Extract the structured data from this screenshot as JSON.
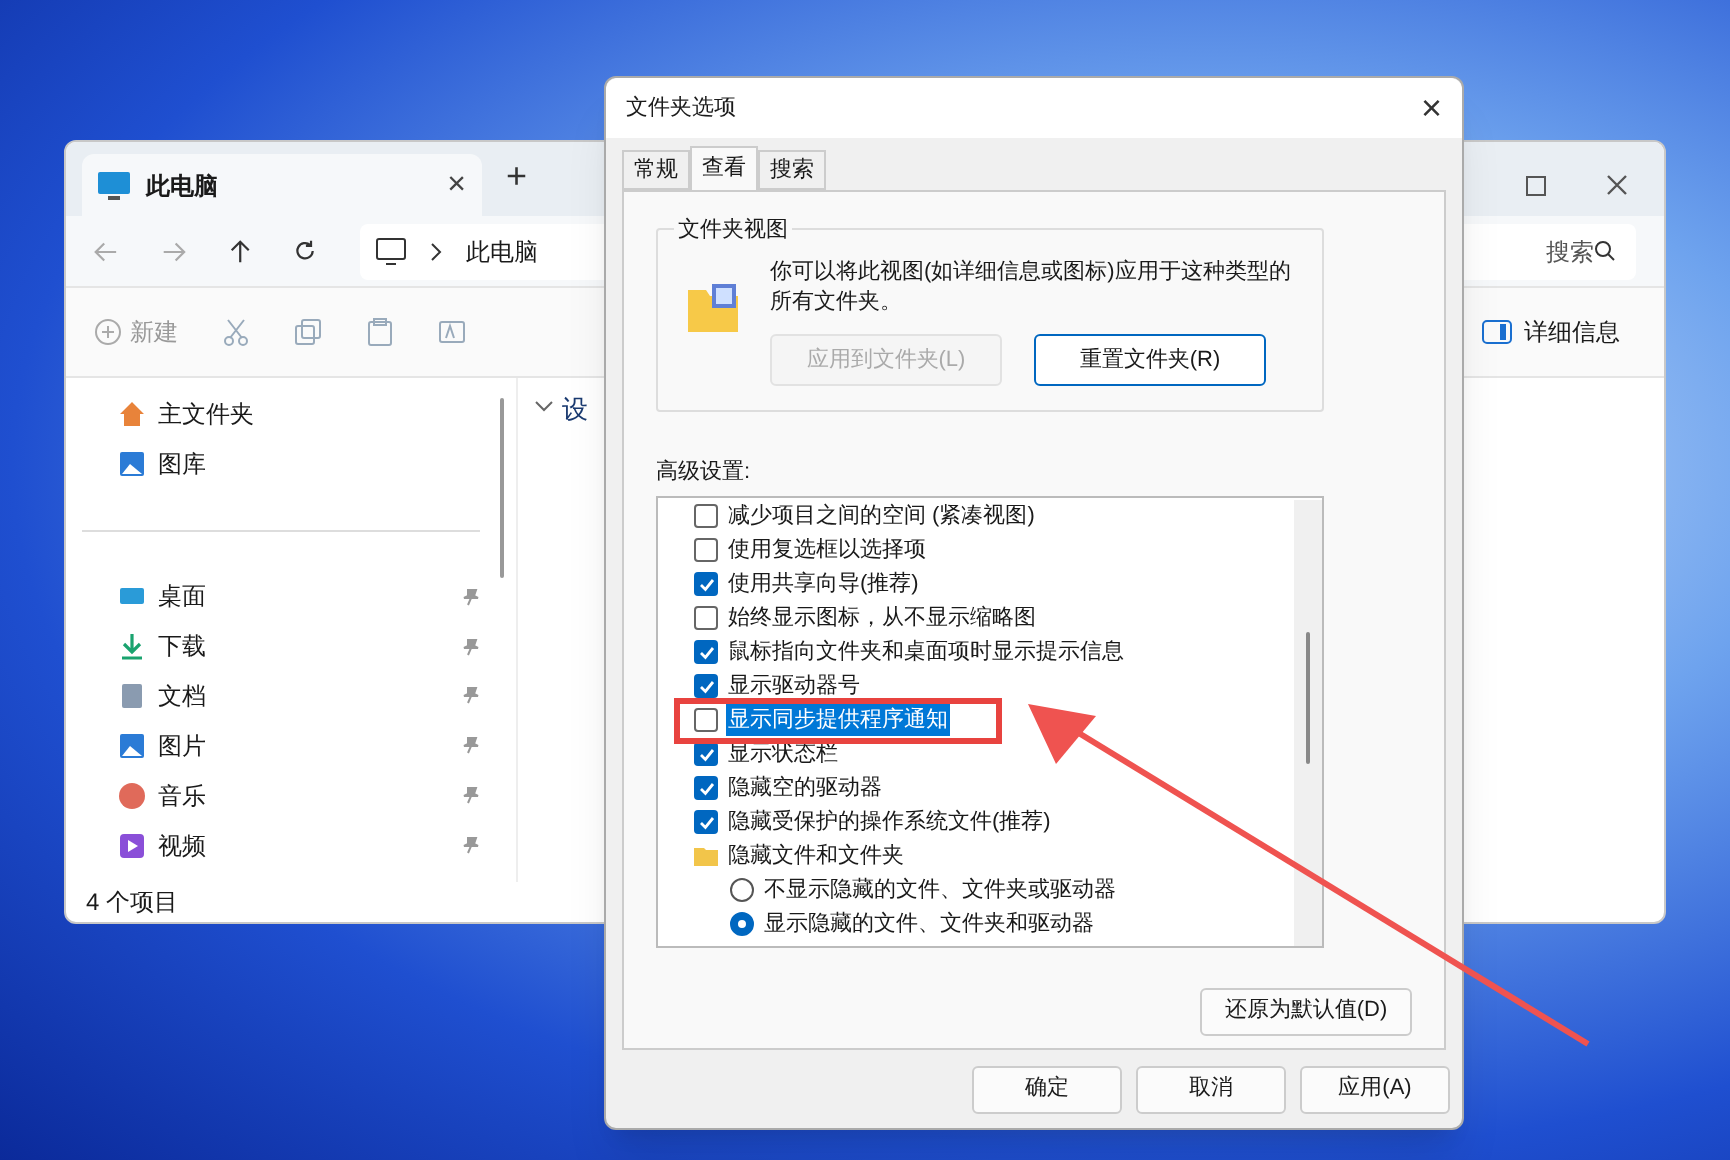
{
  "explorer": {
    "tab": {
      "title": "此电脑",
      "close": "×"
    },
    "new_tab": "+",
    "address": "此电脑",
    "search": {
      "placeholder": "搜索"
    },
    "toolbar": {
      "new": "新建",
      "details": "详细信息"
    },
    "sidebar": {
      "items": [
        {
          "label": "主文件夹",
          "kind": "home",
          "pinned": false
        },
        {
          "label": "图库",
          "kind": "gallery",
          "pinned": false
        },
        {
          "label": "桌面",
          "kind": "desktop",
          "pinned": true
        },
        {
          "label": "下载",
          "kind": "downloads",
          "pinned": true
        },
        {
          "label": "文档",
          "kind": "documents",
          "pinned": true
        },
        {
          "label": "图片",
          "kind": "pictures",
          "pinned": true
        },
        {
          "label": "音乐",
          "kind": "music",
          "pinned": true
        },
        {
          "label": "视频",
          "kind": "videos",
          "pinned": true
        }
      ]
    },
    "section": "设",
    "status": "4 个项目"
  },
  "dialog": {
    "title": "文件夹选项",
    "close": "×",
    "tabs": [
      {
        "label": "常规",
        "selected": false
      },
      {
        "label": "查看",
        "selected": true
      },
      {
        "label": "搜索",
        "selected": false
      }
    ],
    "group": {
      "title": "文件夹视图",
      "text": "你可以将此视图(如详细信息或图标)应用于这种类型的所有文件夹。",
      "buttons": [
        {
          "label": "应用到文件夹(L)",
          "disabled": true
        },
        {
          "label": "重置文件夹(R)",
          "disabled": false
        }
      ]
    },
    "advanced_label": "高级设置:",
    "settings": [
      {
        "kind": "checkbox",
        "label": "减少项目之间的空间 (紧凑视图)",
        "checked": false,
        "selected": false
      },
      {
        "kind": "checkbox",
        "label": "使用复选框以选择项",
        "checked": false,
        "selected": false
      },
      {
        "kind": "checkbox",
        "label": "使用共享向导(推荐)",
        "checked": true,
        "selected": false
      },
      {
        "kind": "checkbox",
        "label": "始终显示图标，从不显示缩略图",
        "checked": false,
        "selected": false
      },
      {
        "kind": "checkbox",
        "label": "鼠标指向文件夹和桌面项时显示提示信息",
        "checked": true,
        "selected": false
      },
      {
        "kind": "checkbox",
        "label": "显示驱动器号",
        "checked": true,
        "selected": false
      },
      {
        "kind": "checkbox",
        "label": "显示同步提供程序通知",
        "checked": false,
        "selected": true
      },
      {
        "kind": "checkbox",
        "label": "显示状态栏",
        "checked": true,
        "selected": false
      },
      {
        "kind": "checkbox",
        "label": "隐藏空的驱动器",
        "checked": true,
        "selected": false
      },
      {
        "kind": "checkbox",
        "label": "隐藏受保护的操作系统文件(推荐)",
        "checked": true,
        "selected": false
      },
      {
        "kind": "folder",
        "label": "隐藏文件和文件夹",
        "children": [
          {
            "kind": "radio",
            "label": "不显示隐藏的文件、文件夹或驱动器",
            "checked": false,
            "selected": false
          },
          {
            "kind": "radio",
            "label": "显示隐藏的文件、文件夹和驱动器",
            "checked": true,
            "selected": false
          }
        ]
      }
    ],
    "restore": "还原为默认值(D)",
    "footer_buttons": [
      "确定",
      "取消",
      "应用(A)"
    ]
  }
}
